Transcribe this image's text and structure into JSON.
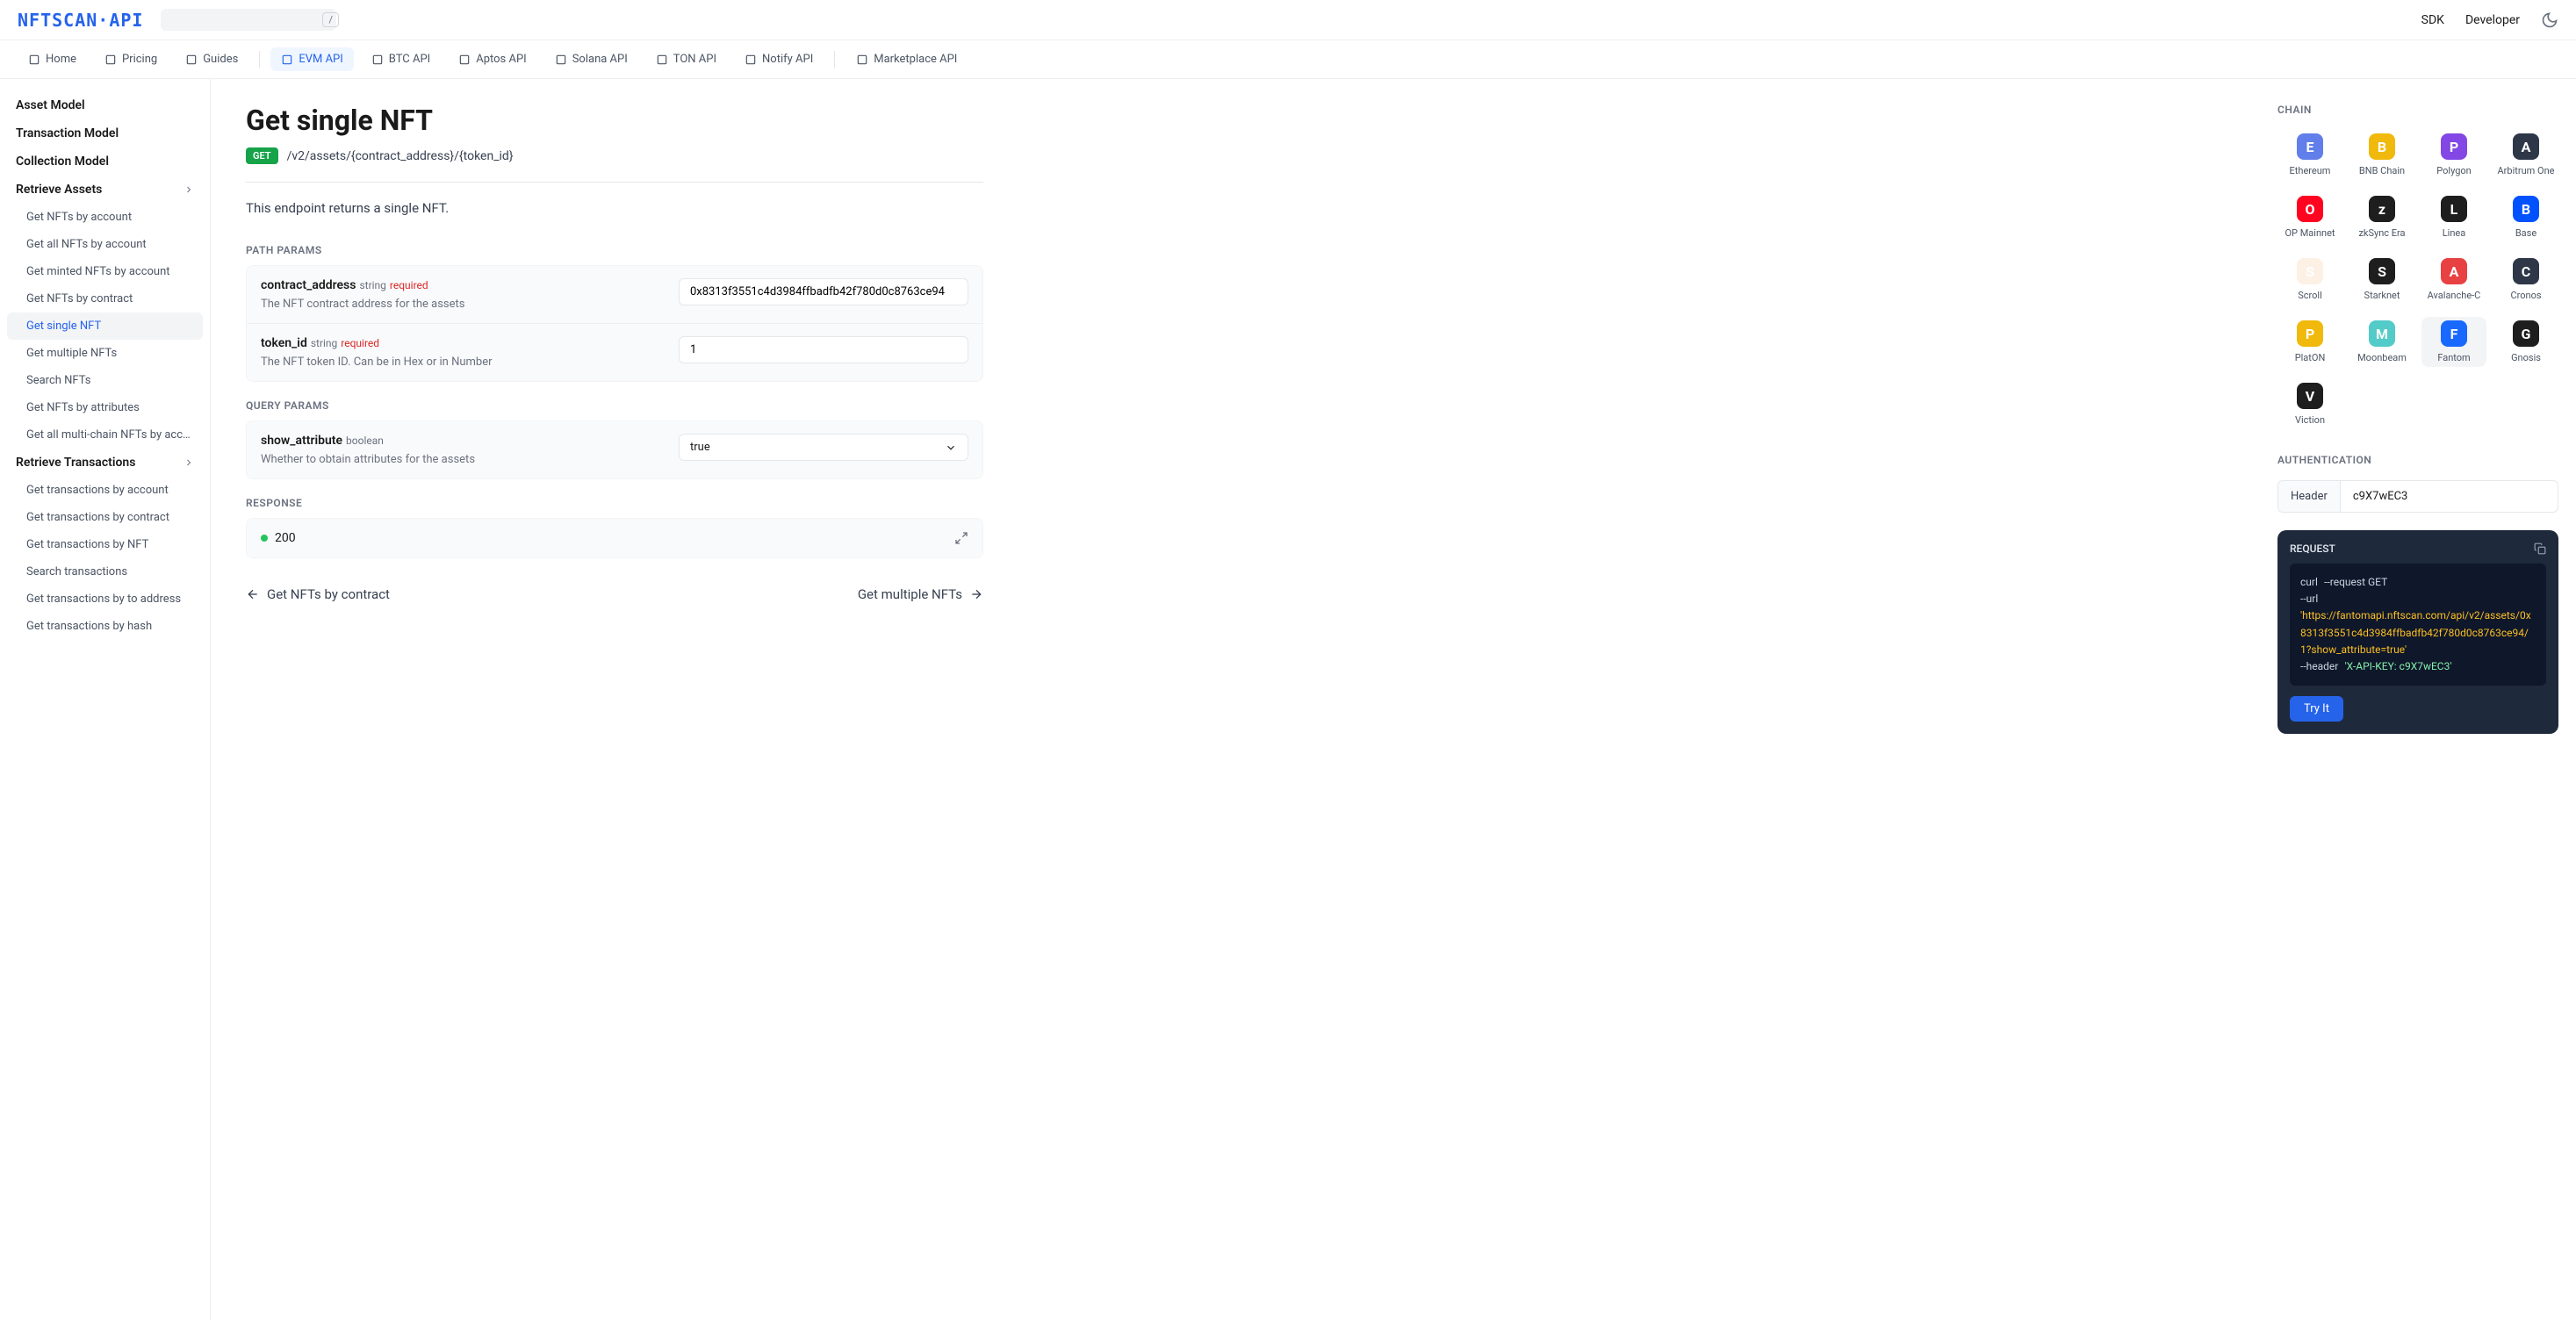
{
  "header": {
    "logo": "NFTSCAN·API",
    "search_placeholder": "",
    "slash": "/",
    "links": {
      "sdk": "SDK",
      "developer": "Developer"
    }
  },
  "nav": [
    {
      "label": "Home",
      "icon": "home"
    },
    {
      "label": "Pricing",
      "icon": "tag"
    },
    {
      "label": "Guides",
      "icon": "diamond"
    },
    {
      "label": "EVM API",
      "icon": "plus-box",
      "active": true
    },
    {
      "label": "BTC API",
      "icon": "bitcoin"
    },
    {
      "label": "Aptos API",
      "icon": "rect"
    },
    {
      "label": "Solana API",
      "icon": "rect"
    },
    {
      "label": "TON API",
      "icon": "dash"
    },
    {
      "label": "Notify API",
      "icon": "bell"
    },
    {
      "label": "Marketplace API",
      "icon": "grid"
    }
  ],
  "sidebar": {
    "sections": [
      {
        "label": "Asset Model",
        "items": []
      },
      {
        "label": "Transaction Model",
        "items": []
      },
      {
        "label": "Collection Model",
        "items": []
      },
      {
        "label": "Retrieve Assets",
        "expandable": true,
        "items": [
          "Get NFTs by account",
          "Get all NFTs by account",
          "Get minted NFTs by account",
          "Get NFTs by contract",
          "Get single NFT",
          "Get multiple NFTs",
          "Search NFTs",
          "Get NFTs by attributes",
          "Get all multi-chain NFTs by account"
        ],
        "active_index": 4
      },
      {
        "label": "Retrieve Transactions",
        "expandable": true,
        "items": [
          "Get transactions by account",
          "Get transactions by contract",
          "Get transactions by NFT",
          "Search transactions",
          "Get transactions by to address",
          "Get transactions by hash"
        ]
      }
    ]
  },
  "page": {
    "title": "Get single NFT",
    "method": "GET",
    "path": "/v2/assets/{contract_address}/{token_id}",
    "description": "This endpoint returns a single NFT.",
    "path_params_label": "PATH PARAMS",
    "query_params_label": "QUERY PARAMS",
    "response_label": "RESPONSE",
    "path_params": [
      {
        "name": "contract_address",
        "type": "string",
        "required": "required",
        "desc": "The NFT contract address for the assets",
        "value": "0x8313f3551c4d3984ffbadfb42f780d0c8763ce94"
      },
      {
        "name": "token_id",
        "type": "string",
        "required": "required",
        "desc": "The NFT token ID. Can be in Hex or in Number",
        "value": "1"
      }
    ],
    "query_params": [
      {
        "name": "show_attribute",
        "type": "boolean",
        "desc": "Whether to obtain attributes for the assets",
        "value": "true"
      }
    ],
    "response": {
      "code": "200"
    },
    "prev": "Get NFTs by contract",
    "next": "Get multiple NFTs"
  },
  "right": {
    "chain_label": "CHAIN",
    "chains": [
      {
        "name": "Ethereum",
        "color": "#627eea"
      },
      {
        "name": "BNB Chain",
        "color": "#f0b90b"
      },
      {
        "name": "Polygon",
        "color": "#8247e5"
      },
      {
        "name": "Arbitrum One",
        "color": "#2d3748"
      },
      {
        "name": "OP Mainnet",
        "color": "#ff0420"
      },
      {
        "name": "zkSync Era",
        "color": "#1e1e1e"
      },
      {
        "name": "Linea",
        "color": "#1e1e1e"
      },
      {
        "name": "Base",
        "color": "#0052ff"
      },
      {
        "name": "Scroll",
        "color": "#fdf1e6"
      },
      {
        "name": "Starknet",
        "color": "#1e1e1e"
      },
      {
        "name": "Avalanche-C",
        "color": "#e84142"
      },
      {
        "name": "Cronos",
        "color": "#2d3748"
      },
      {
        "name": "PlatON",
        "color": "#f0b90b"
      },
      {
        "name": "Moonbeam",
        "color": "#53cbc8"
      },
      {
        "name": "Fantom",
        "color": "#1969ff",
        "selected": true
      },
      {
        "name": "Gnosis",
        "color": "#1e1e1e"
      },
      {
        "name": "Viction",
        "color": "#1e1e1e"
      }
    ],
    "auth_label": "AUTHENTICATION",
    "auth": {
      "header_label": "Header",
      "value": "c9X7wEC3"
    },
    "request_label": "REQUEST",
    "code": {
      "curl": "curl",
      "request_flag": "--request GET",
      "url_flag": "--url",
      "url": "'https://fantomapi.nftscan.com/api/v2/assets/0x8313f3551c4d3984ffbadfb42f780d0c8763ce94/1?show_attribute=true'",
      "header_flag": "--header",
      "header_val": "'X-API-KEY: c9X7wEC3'"
    },
    "try_label": "Try It"
  }
}
